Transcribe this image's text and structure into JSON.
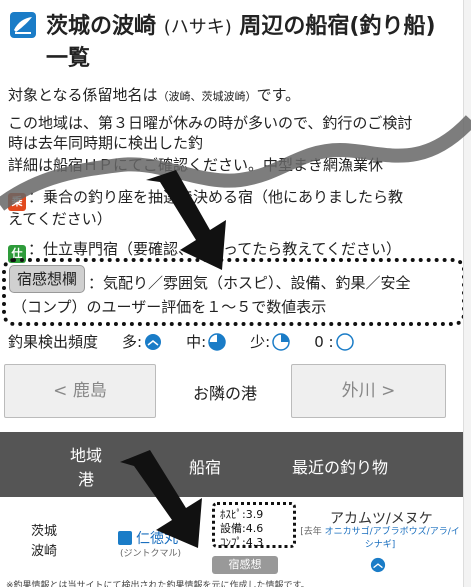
{
  "page": {
    "title_prefix": "茨城の波崎",
    "title_reading": "(ハサキ)",
    "title_suffix": "周辺の船宿(釣り船)",
    "title_line2": "一覧"
  },
  "intro": {
    "line1_a": "対象となる係留地名は",
    "line1_small": "（波崎、茨城波崎）",
    "line1_b": "です。",
    "line2": "この地域は、第３日曜が休みの時が多いので、釣行のご検討",
    "line3": "時は去年同時期に検出した釣",
    "line4": "詳細は船宿ＨＰにてご確認ください。中型まき網漁業休"
  },
  "legend": {
    "red_badge": "乗",
    "red_text": "：乗合の釣り座を抽選で決める宿（他にありましたら教",
    "red_text2": "えてください）",
    "green_badge": "仕",
    "green_text": "：仕立専門宿（要確認、間違ってたら教えてください）",
    "review_tag": "宿感想欄",
    "review_text1": "：気配り／雰囲気（ホスピ）、設備、釣果／安全",
    "review_text2": "（コンプ）のユーザー評価を１～５で数値表示"
  },
  "frequency": {
    "label": "釣果検出頻度",
    "levels": [
      {
        "label": "多:",
        "fill": 1.0
      },
      {
        "label": "中:",
        "fill": 0.75
      },
      {
        "label": "少:",
        "fill": 0.25
      },
      {
        "label": "0 :",
        "fill": 0.0
      }
    ]
  },
  "nav": {
    "prev_label": "< 鹿島",
    "center_label": "お隣の港",
    "next_label": "外川 >"
  },
  "table": {
    "headers": {
      "region_port_1": "地域",
      "region_port_2": "港",
      "shop": "船宿",
      "recent": "最近の釣り物"
    },
    "rows": [
      {
        "region": "茨城",
        "port": "波崎",
        "shop_name": "仁徳丸",
        "shop_kana": "(ジントクマル)",
        "ratings": {
          "hospi": "ﾎｽﾋﾟ:3.9",
          "equip": "設備:4.6",
          "comp": "ｺﾝﾌﾟ:4.3"
        },
        "review_button": "宿感想",
        "catch_main": "アカムツ/メヌケ",
        "catch_sub_prefix": "[去年",
        "catch_sub_body": "オニカサゴ/アブラボウズ/アラ/イシナギ]",
        "frequency_fill": 1.0
      }
    ]
  },
  "footer": {
    "cut_text": "※釣果情報とは当サイトにて検出された釣果情報を元に作成した情報です。"
  },
  "colors": {
    "brand_blue": "#1a7cc7",
    "red_badge": "#e2491e",
    "green_badge": "#2e9b3a",
    "table_header_bg": "#555555"
  }
}
